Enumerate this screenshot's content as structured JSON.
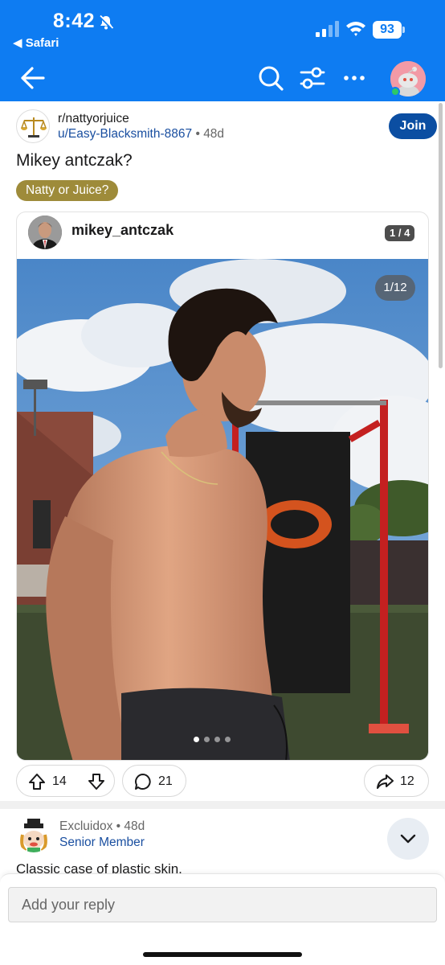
{
  "status": {
    "time": "8:42",
    "back_app": "Safari",
    "battery": "93"
  },
  "nav": {
    "icons": [
      "back-arrow-icon",
      "search-icon",
      "filter-icon",
      "more-icon",
      "avatar"
    ]
  },
  "post": {
    "subreddit": "r/nattyorjuice",
    "author": "u/Easy-Blacksmith-8867",
    "separator": "•",
    "age": "48d",
    "join_label": "Join",
    "title": "Mikey antczak?",
    "flair": "Natty or Juice?",
    "embed": {
      "username": "mikey_antczak",
      "post_counter": "1 / 4",
      "image_counter": "1/12",
      "dots_total": 4,
      "dots_active": 1
    },
    "actions": {
      "upvotes": "14",
      "comments": "21",
      "shares": "12"
    }
  },
  "comment": {
    "username": "Excluidox",
    "separator": "•",
    "age": "48d",
    "flair": "Senior Member",
    "text": "Classic case of plastic skin."
  },
  "reply": {
    "placeholder": "Add your reply"
  },
  "colors": {
    "topbar": "#0e7cf2",
    "join": "#0b4ea2",
    "flair": "#9e8b3a",
    "link": "#1a4fa0"
  }
}
